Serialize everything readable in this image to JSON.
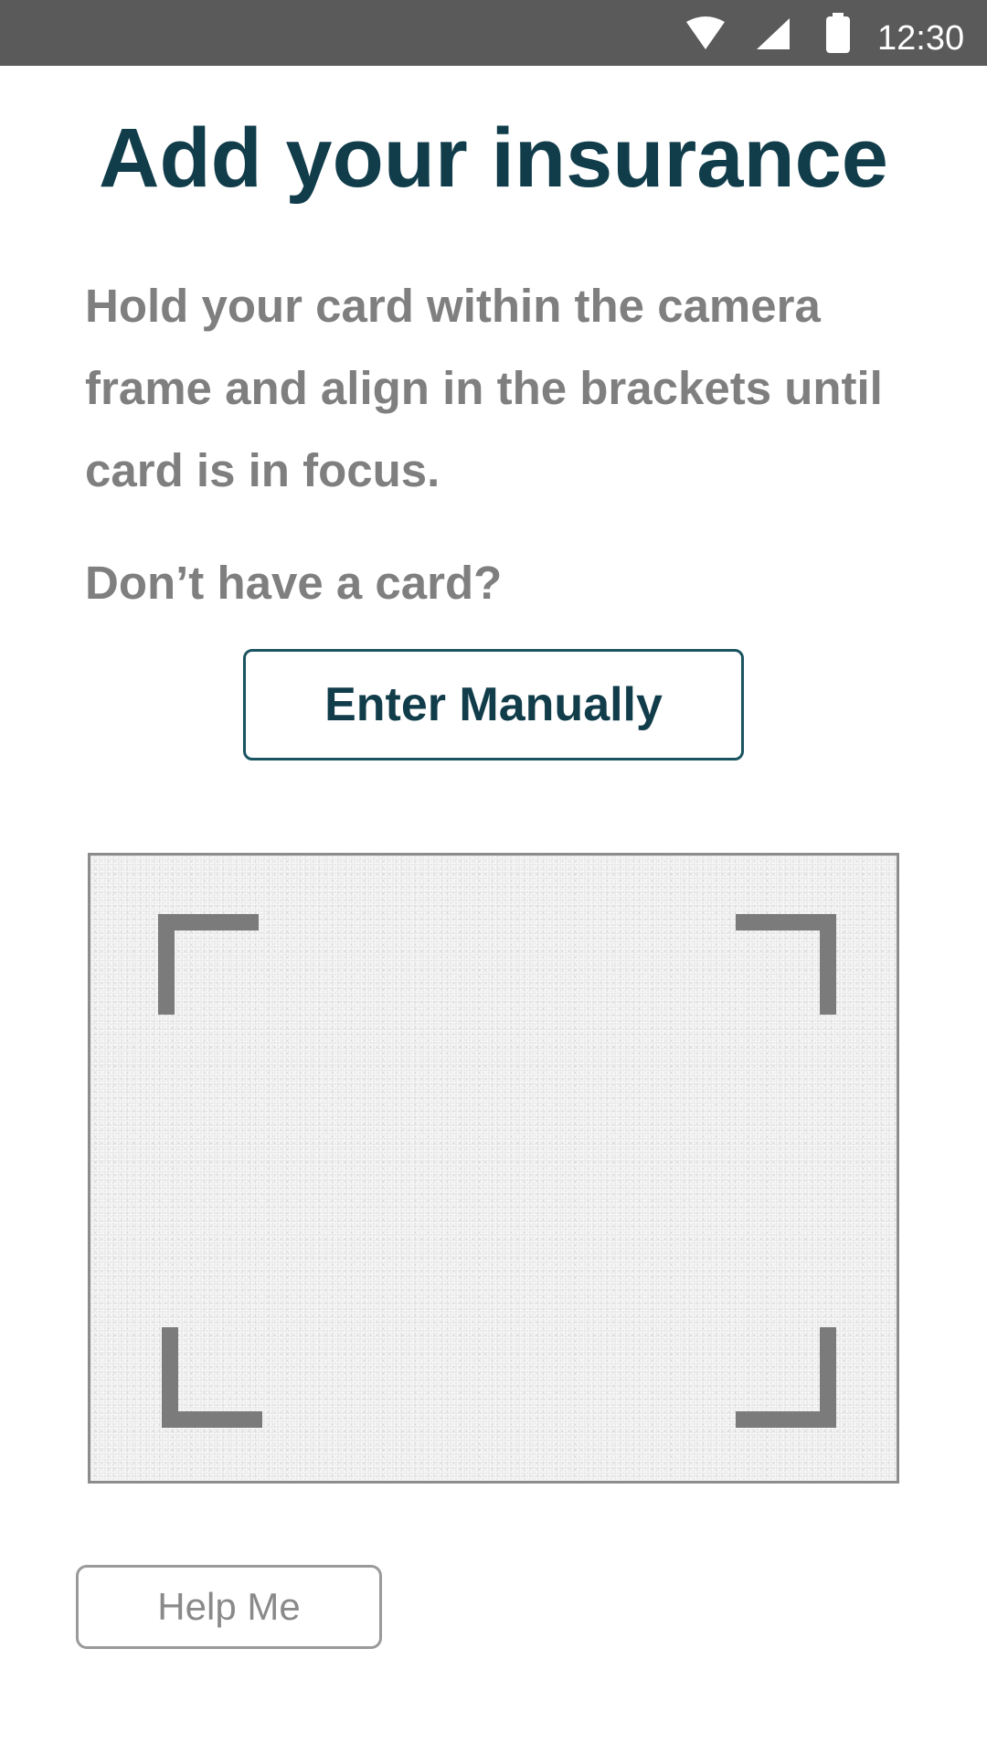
{
  "status_bar": {
    "time": "12:30",
    "icons": [
      "wifi-icon",
      "signal-icon",
      "battery-icon"
    ]
  },
  "page": {
    "title": "Add your insurance",
    "instructions": "Hold your card within the camera frame and align in the brackets until card is in focus.",
    "no_card_prompt": "Don’t have a card?",
    "enter_manually_label": "Enter Manually",
    "help_label": "Help Me"
  },
  "colors": {
    "title": "#113d4b",
    "body_text": "#7f7f7f",
    "status_bar": "#5a5a5a",
    "button_border": "#1b5461",
    "bracket": "#7b7b7b"
  }
}
